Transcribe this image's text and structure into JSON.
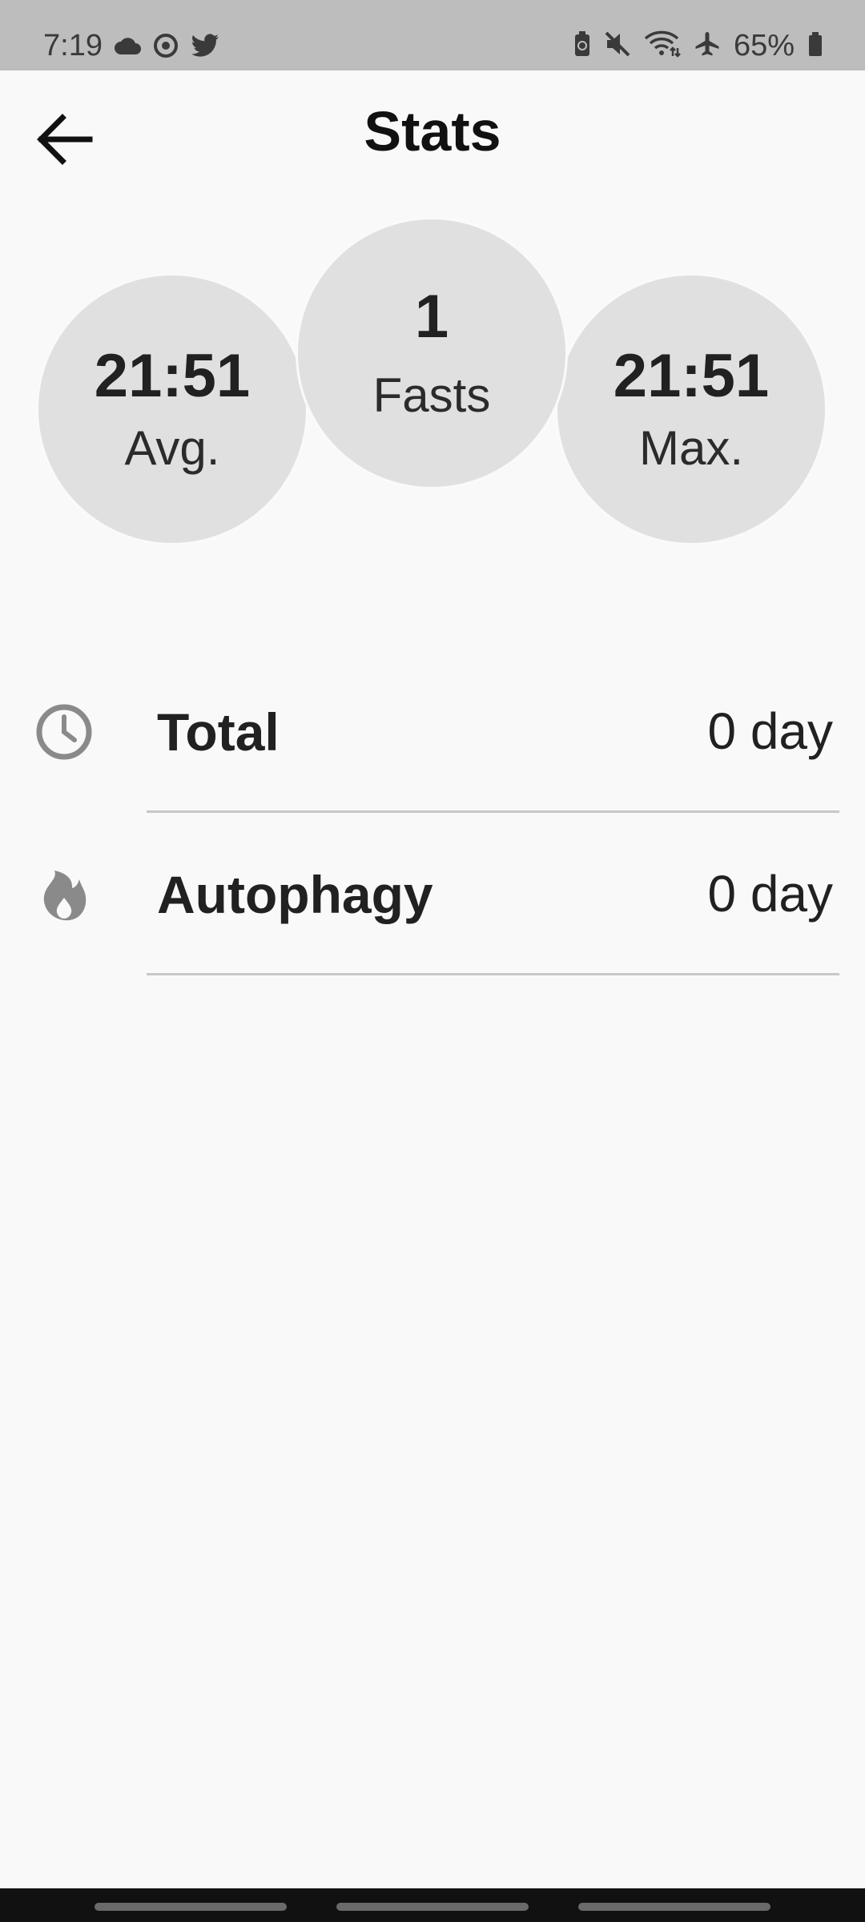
{
  "status_bar": {
    "time": "7:19",
    "battery_percent": "65%",
    "left_icons": [
      "cloud-icon",
      "sync-icon",
      "twitter-icon"
    ],
    "right_icons": [
      "battery-saver-icon",
      "mute-icon",
      "wifi-icon",
      "airplane-icon",
      "battery-icon"
    ]
  },
  "header": {
    "title": "Stats",
    "back_icon": "arrow-left-icon"
  },
  "summary": {
    "avg": {
      "value": "21:51",
      "label": "Avg."
    },
    "fasts": {
      "value": "1",
      "label": "Fasts"
    },
    "max": {
      "value": "21:51",
      "label": "Max."
    }
  },
  "stats": [
    {
      "icon": "clock-icon",
      "label": "Total",
      "value": "0 day"
    },
    {
      "icon": "flame-icon",
      "label": "Autophagy",
      "value": "0 day"
    }
  ],
  "colors": {
    "background": "#f9f9f9",
    "status_bar": "#bdbdbd",
    "circle": "#e0e0e0",
    "icon_gray": "#8a8a8a",
    "divider": "#c8c8c8"
  }
}
